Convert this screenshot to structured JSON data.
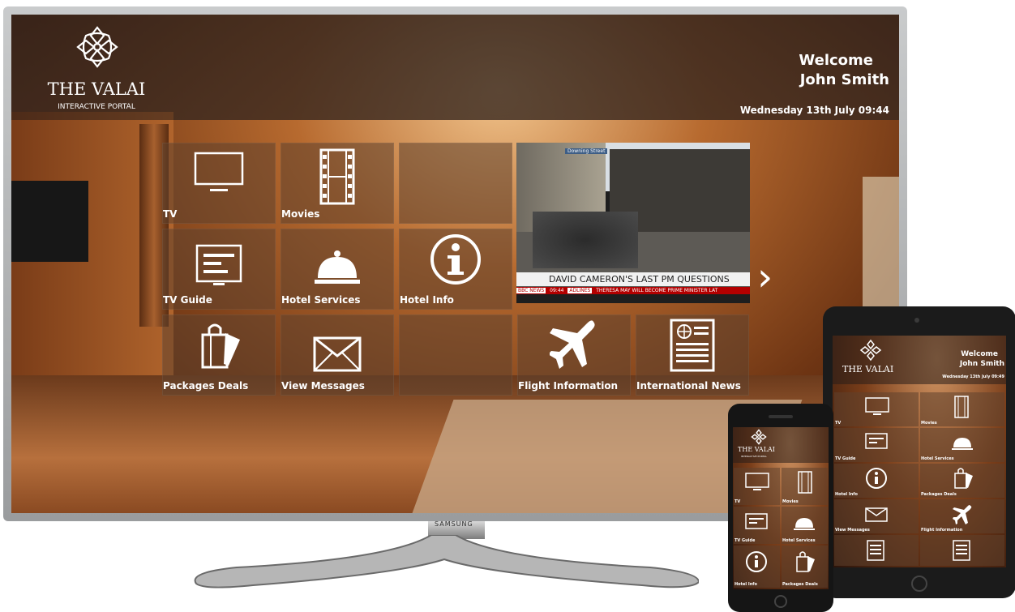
{
  "tv_portal": {
    "brand_name": "THE VALAI",
    "brand_subtitle": "INTERACTIVE PORTAL",
    "welcome_line": "Welcome",
    "guest_name": "John Smith",
    "datetime": "Wednesday 13th July 09:44",
    "tiles": [
      {
        "label": "TV",
        "icon": "tv-icon"
      },
      {
        "label": "Movies",
        "icon": "film-icon"
      },
      {
        "label": "TV Guide",
        "icon": "guide-icon"
      },
      {
        "label": "Hotel Services",
        "icon": "bell-icon"
      },
      {
        "label": "Hotel Info",
        "icon": "info-icon"
      },
      {
        "label": "Packages Deals",
        "icon": "shopping-bag-icon"
      },
      {
        "label": "View Messages",
        "icon": "envelope-icon"
      },
      {
        "label": "Flight Information",
        "icon": "airplane-icon"
      },
      {
        "label": "International News",
        "icon": "newspaper-icon"
      }
    ],
    "live_tv": {
      "location_tag": "Downing Street",
      "headline": "DAVID CAMERON'S LAST PM QUESTIONS",
      "channel": "BBC NEWS",
      "time": "09:44",
      "ticker_label": "ADLINES",
      "ticker_text": "THERESA MAY WILL BECOME PRIME MINISTER LAT"
    },
    "next_arrow": "›"
  },
  "tv_brand": "SAMSUNG",
  "tablet_portal": {
    "brand_name": "THE VALAI",
    "welcome_line": "Welcome",
    "guest_name": "John Smith",
    "datetime": "Wednesday 13th July 09:49",
    "tiles": [
      {
        "label": "TV",
        "icon": "tv-icon"
      },
      {
        "label": "Movies",
        "icon": "film-icon"
      },
      {
        "label": "TV Guide",
        "icon": "guide-icon"
      },
      {
        "label": "Hotel Services",
        "icon": "bell-icon"
      },
      {
        "label": "Hotel Info",
        "icon": "info-icon"
      },
      {
        "label": "Packages Deals",
        "icon": "shopping-bag-icon"
      },
      {
        "label": "View Messages",
        "icon": "envelope-icon"
      },
      {
        "label": "Flight Information",
        "icon": "airplane-icon"
      },
      {
        "label": "",
        "icon": "newspaper-icon"
      },
      {
        "label": "",
        "icon": "newspaper-icon"
      }
    ]
  },
  "phone_portal": {
    "brand_name": "THE VALAI",
    "brand_subtitle": "INTERACTIVE PORTAL",
    "tiles": [
      {
        "label": "TV",
        "icon": "tv-icon"
      },
      {
        "label": "Movies",
        "icon": "film-icon"
      },
      {
        "label": "TV Guide",
        "icon": "guide-icon"
      },
      {
        "label": "Hotel Services",
        "icon": "bell-icon"
      },
      {
        "label": "Hotel Info",
        "icon": "info-icon"
      },
      {
        "label": "Packages Deals",
        "icon": "shopping-bag-icon"
      }
    ]
  }
}
